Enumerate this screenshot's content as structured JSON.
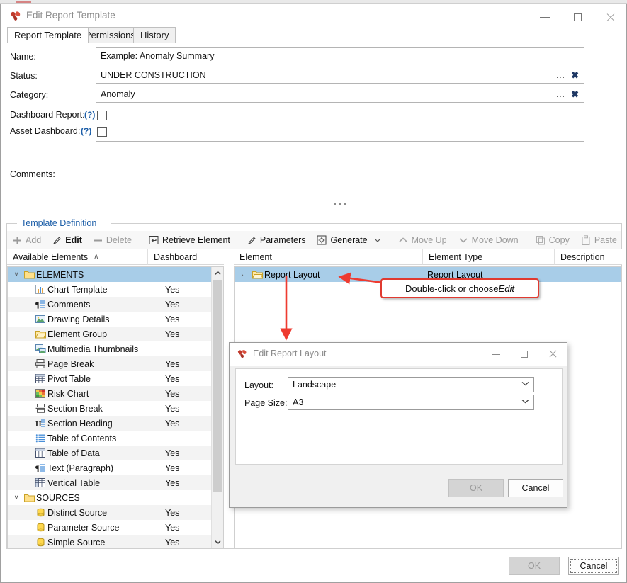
{
  "window": {
    "title": "Edit Report Template",
    "icon": "app-logo-icon",
    "minimize": "–",
    "maximize": "□",
    "close": "✕"
  },
  "tabs": [
    {
      "label": "Report Template",
      "active": true
    },
    {
      "label": "Permissions",
      "active": false
    },
    {
      "label": "History",
      "active": false
    }
  ],
  "form": {
    "name_label": "Name:",
    "name_value": "Example: Anomaly Summary",
    "status_label": "Status:",
    "status_value": "UNDER CONSTRUCTION",
    "category_label": "Category:",
    "category_value": "Anomaly",
    "dashboard_report_label": "Dashboard Report:",
    "dashboard_report_help": "(?)",
    "dashboard_report_checked": false,
    "asset_dashboard_label": "Asset Dashboard:",
    "asset_dashboard_help": "(?)",
    "asset_dashboard_checked": false,
    "comments_label": "Comments:",
    "comments_value": "",
    "ellipsis_button": "...",
    "clear_button": "✖"
  },
  "group": {
    "title": "Template Definition"
  },
  "toolbar": [
    {
      "label": "Add",
      "icon": "plus-icon",
      "enabled": false
    },
    {
      "label": "Edit",
      "icon": "pencil-icon",
      "enabled": true
    },
    {
      "label": "Delete",
      "icon": "minus-icon",
      "enabled": false
    },
    {
      "label": "Retrieve Element",
      "icon": "retrieve-icon",
      "enabled": true
    },
    {
      "label": "Parameters",
      "icon": "pencil-icon",
      "enabled": true
    },
    {
      "label": "Generate",
      "icon": "gear-doc-icon",
      "enabled": true,
      "dropdown": true
    },
    {
      "label": "Move Up",
      "icon": "chevron-up-icon",
      "enabled": false
    },
    {
      "label": "Move Down",
      "icon": "chevron-down-icon",
      "enabled": false
    },
    {
      "label": "Copy",
      "icon": "copy-icon",
      "enabled": false
    },
    {
      "label": "Paste",
      "icon": "paste-icon",
      "enabled": false
    }
  ],
  "left_panel": {
    "col_elements": "Available Elements",
    "col_dashboard": "Dashboard",
    "sort_caret": "∧",
    "rows": [
      {
        "label": "ELEMENTS",
        "icon": "folder-icon",
        "dashboard": "",
        "group": true,
        "selected": true,
        "expander": "∨"
      },
      {
        "label": "Chart Template",
        "icon": "chart-template-icon",
        "dashboard": "Yes"
      },
      {
        "label": "Comments",
        "icon": "paragraph-icon",
        "dashboard": "Yes"
      },
      {
        "label": "Drawing Details",
        "icon": "image-icon",
        "dashboard": "Yes"
      },
      {
        "label": "Element Group",
        "icon": "folder-open-icon",
        "dashboard": "Yes"
      },
      {
        "label": "Multimedia Thumbnails",
        "icon": "multimedia-icon",
        "dashboard": ""
      },
      {
        "label": "Page Break",
        "icon": "page-break-icon",
        "dashboard": "Yes"
      },
      {
        "label": "Pivot Table",
        "icon": "table-icon",
        "dashboard": "Yes"
      },
      {
        "label": "Risk Chart",
        "icon": "risk-matrix-icon",
        "dashboard": "Yes"
      },
      {
        "label": "Section Break",
        "icon": "section-break-icon",
        "dashboard": "Yes"
      },
      {
        "label": "Section Heading",
        "icon": "heading-icon",
        "dashboard": "Yes"
      },
      {
        "label": "Table of Contents",
        "icon": "toc-icon",
        "dashboard": ""
      },
      {
        "label": "Table of Data",
        "icon": "table-icon",
        "dashboard": "Yes"
      },
      {
        "label": "Text (Paragraph)",
        "icon": "paragraph-icon",
        "dashboard": "Yes"
      },
      {
        "label": "Vertical Table",
        "icon": "vertical-table-icon",
        "dashboard": "Yes"
      },
      {
        "label": "SOURCES",
        "icon": "folder-icon",
        "dashboard": "",
        "group": true,
        "expander": "∨"
      },
      {
        "label": "Distinct Source",
        "icon": "database-icon",
        "dashboard": "Yes"
      },
      {
        "label": "Parameter Source",
        "icon": "database-icon",
        "dashboard": "Yes"
      },
      {
        "label": "Simple Source",
        "icon": "database-icon",
        "dashboard": "Yes"
      }
    ],
    "scroll_up": "∧",
    "scroll_down": "∨"
  },
  "right_panel": {
    "col_element": "Element",
    "col_element_type": "Element Type",
    "col_description": "Description",
    "rows": [
      {
        "label": "Report Layout",
        "type": "Report Layout",
        "icon": "folder-open-icon",
        "expander": "›",
        "selected": true
      }
    ]
  },
  "callout": {
    "text_before": "Double-click or choose ",
    "text_emphasis": "Edit",
    "border_color": "#e03a30"
  },
  "dialog": {
    "title": "Edit Report Layout",
    "icon": "app-logo-icon",
    "minimize": "–",
    "maximize": "□",
    "close": "✕",
    "layout_label": "Layout:",
    "layout_value": "Landscape",
    "page_size_label": "Page Size:",
    "page_size_value": "A3",
    "dropdown_caret": "∨",
    "ok_label": "OK",
    "cancel_label": "Cancel",
    "ok_enabled": false
  },
  "footer": {
    "ok_label": "OK",
    "cancel_label": "Cancel",
    "ok_enabled": false
  }
}
